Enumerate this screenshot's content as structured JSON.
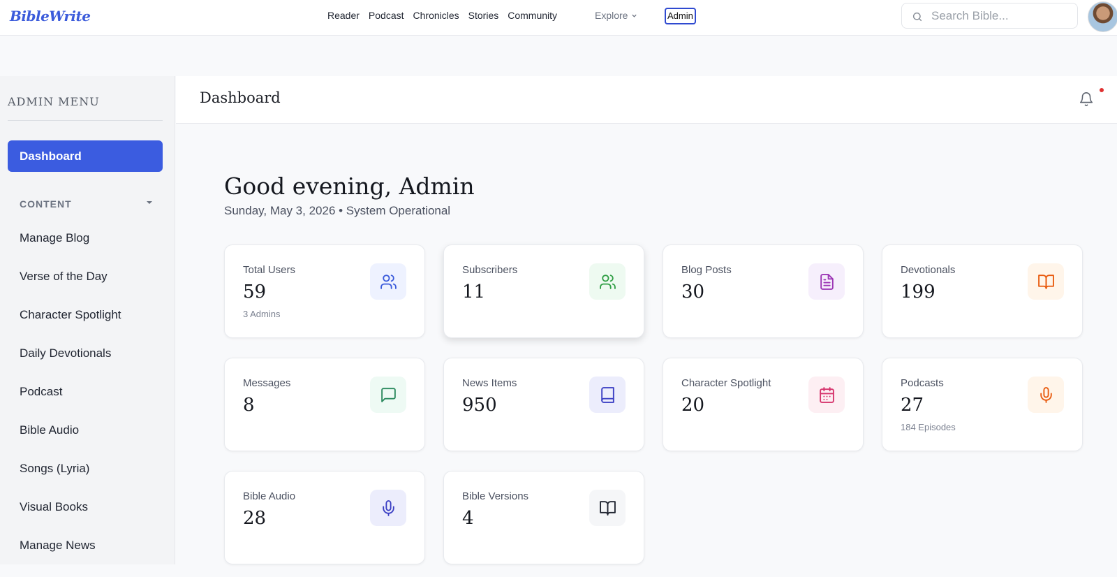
{
  "app": {
    "logo": "BibleWrite"
  },
  "nav": {
    "links": [
      "Reader",
      "Podcast",
      "Chronicles",
      "Stories",
      "Community"
    ],
    "explore": "Explore",
    "admin": "Admin"
  },
  "search": {
    "placeholder": "Search Bible..."
  },
  "sidebar": {
    "title": "ADMIN MENU",
    "active": "Dashboard",
    "section": "CONTENT",
    "items": [
      "Manage Blog",
      "Verse of the Day",
      "Character Spotlight",
      "Daily Devotionals",
      "Podcast",
      "Bible Audio",
      "Songs (Lyria)",
      "Visual Books",
      "Manage News"
    ]
  },
  "header": {
    "title": "Dashboard"
  },
  "greeting": {
    "title": "Good evening, Admin",
    "subtitle": "Sunday, May 3, 2026 • System Operational"
  },
  "stats": [
    {
      "label": "Total Users",
      "value": "59",
      "sub": "3 Admins",
      "icon": "users-icon",
      "color": "#3b5bdb",
      "bg": "#eef2ff"
    },
    {
      "label": "Subscribers",
      "value": "11",
      "sub": "",
      "icon": "users-icon",
      "color": "#2f9e44",
      "bg": "#eefaf1"
    },
    {
      "label": "Blog Posts",
      "value": "30",
      "sub": "",
      "icon": "file-text-icon",
      "color": "#9c36b5",
      "bg": "#f6effc"
    },
    {
      "label": "Devotionals",
      "value": "199",
      "sub": "",
      "icon": "book-open-icon",
      "color": "#e8590c",
      "bg": "#fff5ea"
    },
    {
      "label": "Messages",
      "value": "8",
      "sub": "",
      "icon": "message-square-icon",
      "color": "#2b8a5e",
      "bg": "#eefaf4"
    },
    {
      "label": "News Items",
      "value": "950",
      "sub": "",
      "icon": "book-icon",
      "color": "#3b3fc4",
      "bg": "#ecedfc"
    },
    {
      "label": "Character Spotlight",
      "value": "20",
      "sub": "",
      "icon": "calendar-icon",
      "color": "#d6336c",
      "bg": "#fdeff3"
    },
    {
      "label": "Podcasts",
      "value": "27",
      "sub": "184 Episodes",
      "icon": "mic-icon",
      "color": "#e8590c",
      "bg": "#fff5ea"
    },
    {
      "label": "Bible Audio",
      "value": "28",
      "sub": "",
      "icon": "mic-icon",
      "color": "#3b3fc4",
      "bg": "#ecedfc"
    },
    {
      "label": "Bible Versions",
      "value": "4",
      "sub": "",
      "icon": "book-open-icon",
      "color": "#1f2430",
      "bg": "#f5f6f8"
    }
  ]
}
